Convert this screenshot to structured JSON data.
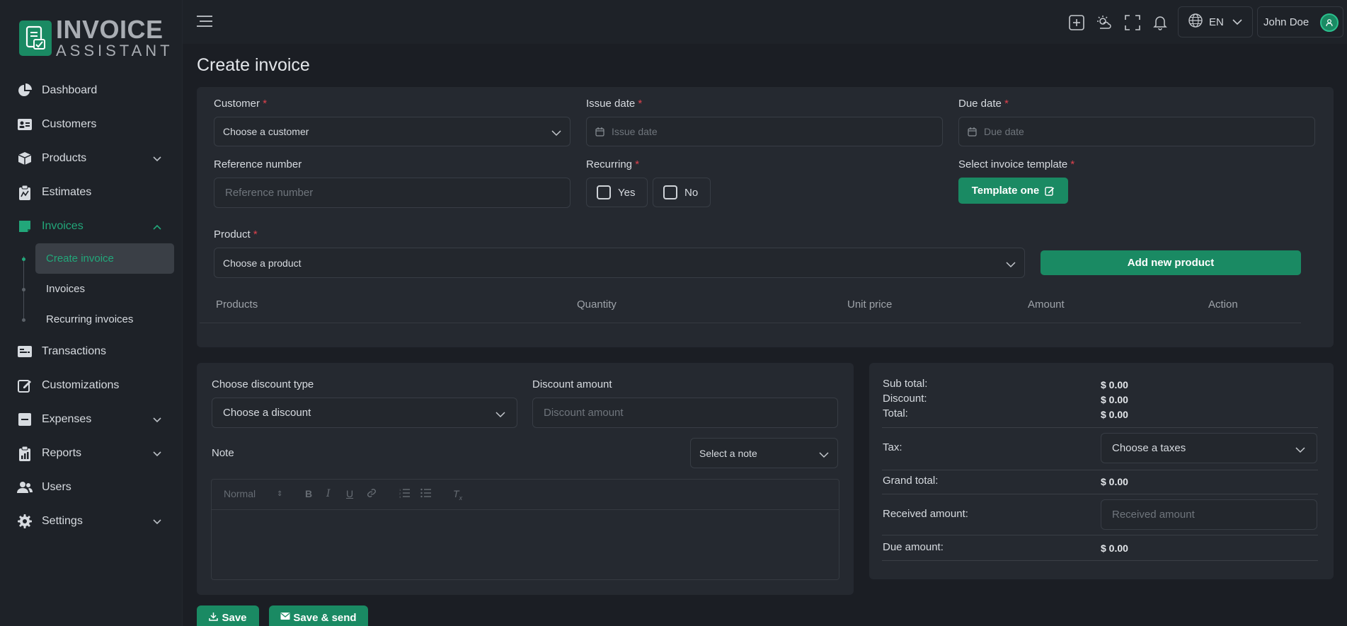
{
  "brand": {
    "line1": "INVOICE",
    "line2": "ASSISTANT"
  },
  "sidebar": {
    "items": [
      {
        "label": "Dashboard",
        "icon": "pie-chart-icon"
      },
      {
        "label": "Customers",
        "icon": "contact-card-icon"
      },
      {
        "label": "Products",
        "icon": "box-icon",
        "expandable": true
      },
      {
        "label": "Estimates",
        "icon": "clipboard-icon"
      },
      {
        "label": "Invoices",
        "icon": "invoice-icon",
        "expandable": true,
        "active": true
      },
      {
        "label": "Transactions",
        "icon": "transactions-icon"
      },
      {
        "label": "Customizations",
        "icon": "edit-icon"
      },
      {
        "label": "Expenses",
        "icon": "minus-square-icon",
        "expandable": true
      },
      {
        "label": "Reports",
        "icon": "report-icon",
        "expandable": true
      },
      {
        "label": "Users",
        "icon": "users-icon"
      },
      {
        "label": "Settings",
        "icon": "gear-icon",
        "expandable": true
      }
    ],
    "invoice_subitems": [
      {
        "label": "Create invoice",
        "active": true
      },
      {
        "label": "Invoices"
      },
      {
        "label": "Recurring invoices"
      }
    ]
  },
  "topbar": {
    "language": "EN",
    "user_name": "John Doe"
  },
  "page": {
    "title": "Create invoice"
  },
  "form": {
    "customer": {
      "label": "Customer",
      "value": "Choose a customer"
    },
    "issue_date": {
      "label": "Issue date",
      "placeholder": "Issue date"
    },
    "due_date": {
      "label": "Due date",
      "placeholder": "Due date"
    },
    "reference": {
      "label": "Reference number",
      "placeholder": "Reference number"
    },
    "recurring": {
      "label": "Recurring",
      "yes": "Yes",
      "no": "No"
    },
    "template": {
      "label": "Select invoice template",
      "button": "Template one"
    },
    "product": {
      "label": "Product",
      "value": "Choose a product",
      "add_button": "Add new product"
    },
    "table_headers": [
      "Products",
      "Quantity",
      "Unit price",
      "Amount",
      "Action"
    ]
  },
  "discount": {
    "type_label": "Choose discount type",
    "type_value": "Choose a discount",
    "amount_label": "Discount amount",
    "amount_placeholder": "Discount amount",
    "note_label": "Note",
    "note_select": "Select a note",
    "editor_format": "Normal"
  },
  "summary": {
    "subtotal_label": "Sub total:",
    "subtotal": "$ 0.00",
    "discount_label": "Discount:",
    "discount": "$ 0.00",
    "total_label": "Total:",
    "total": "$ 0.00",
    "tax_label": "Tax:",
    "tax_value": "Choose a taxes",
    "grand_label": "Grand total:",
    "grand": "$ 0.00",
    "received_label": "Received amount:",
    "received_placeholder": "Received amount",
    "due_label": "Due amount:",
    "due": "$ 0.00"
  },
  "actions": {
    "save": "Save",
    "save_send": "Save & send"
  },
  "colors": {
    "accent": "#1a8a63",
    "accent_text": "#22a77a",
    "required": "#e0424d"
  }
}
